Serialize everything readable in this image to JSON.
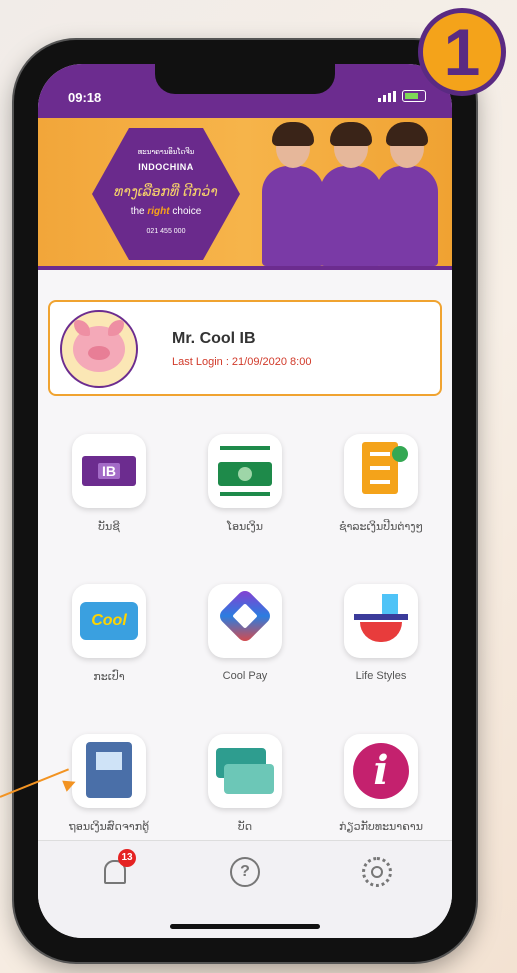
{
  "step_badge": "1",
  "status_bar": {
    "time": "09:18"
  },
  "banner": {
    "hex_top": "ທະນາຄານອິນໂດຈີນ",
    "hex_logo": "INDOCHINA",
    "hex_slogan": "ທາງເລືອກທີ່ ດີກວ່າ",
    "tagline_prefix": "the",
    "tagline_highlight": "right",
    "tagline_suffix": "choice",
    "hex_phone": "021 455 000"
  },
  "profile": {
    "name": "Mr. Cool IB",
    "last_login": "Last Login : 21/09/2020  8:00"
  },
  "menu": [
    {
      "label": "ບັນຊີ",
      "icon": "ib-card-icon"
    },
    {
      "label": "ໂອນເງິນ",
      "icon": "money-transfer-icon"
    },
    {
      "label": "ຊຳລະເງິນປີນຕ່າງໆ",
      "icon": "bill-payment-icon"
    },
    {
      "label": "ກະເປົາ",
      "icon": "cool-wallet-icon"
    },
    {
      "label": "Cool Pay",
      "icon": "cool-pay-icon"
    },
    {
      "label": "Life Styles",
      "icon": "life-styles-icon"
    },
    {
      "label": "ຖອນເງິນສົດຈາກຕູ້",
      "icon": "atm-cash-icon"
    },
    {
      "label": "ບັດ",
      "icon": "cards-icon"
    },
    {
      "label": "ກ່ຽວກັບທະນາຄານ",
      "icon": "info-icon"
    }
  ],
  "bottom_bar": {
    "notification_count": "13"
  },
  "colors": {
    "brand_purple": "#6c2c8f",
    "accent_orange": "#f4a31a",
    "alert_red": "#e52222"
  }
}
